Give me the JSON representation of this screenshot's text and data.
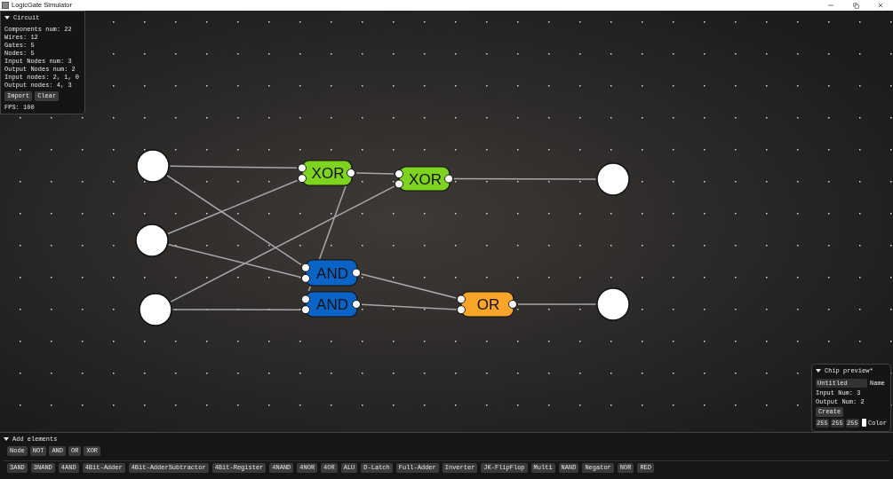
{
  "window": {
    "title": "LogicGate Simulator"
  },
  "circuit_panel": {
    "title": "Circuit",
    "expanded": true,
    "stats": [
      "Components num: 22",
      "Wires: 12",
      "Gates: 5",
      "Nodes: 5",
      "Input Nodes num: 3",
      "Output Nodes num: 2",
      "Input nodes: 2, 1, 0",
      "Output nodes: 4, 3"
    ],
    "buttons": [
      "Import",
      "Clear"
    ],
    "fps": "FPS: 100"
  },
  "canvas": {
    "gates": [
      {
        "label": "XOR",
        "color": "#7ed321"
      },
      {
        "label": "XOR",
        "color": "#7ed321"
      },
      {
        "label": "AND",
        "color": "#0a64c8"
      },
      {
        "label": "AND",
        "color": "#0a64c8"
      },
      {
        "label": "OR",
        "color": "#f8a52a"
      }
    ]
  },
  "chip_preview": {
    "title": "Chip preview*",
    "expanded": true,
    "name_value": "Untitled",
    "name_label": "Name",
    "input_num": "Input Num: 3",
    "output_num": "Output Num: 2",
    "create_button": "Create",
    "color_fields": [
      "255",
      "255",
      "255"
    ],
    "color_label": "Color"
  },
  "add_elements": {
    "title": "Add elements",
    "expanded": true,
    "basic": [
      "Node",
      "NOT",
      "AND",
      "OR",
      "XOR"
    ],
    "chips": [
      "3AND",
      "3NAND",
      "4AND",
      "4Bit-Adder",
      "4Bit-AdderSubtractor",
      "4Bit-Register",
      "4NAND",
      "4NOR",
      "4OR",
      "ALU",
      "D-Latch",
      "Full-Adder",
      "Inverter",
      "JK-FlipFlop",
      "Multi",
      "NAND",
      "Negator",
      "NOR",
      "RED"
    ]
  }
}
